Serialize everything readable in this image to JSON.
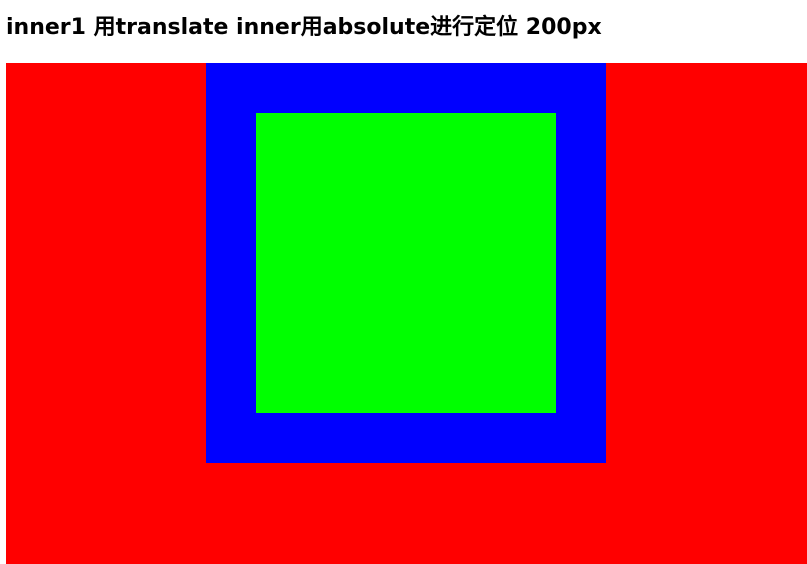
{
  "heading": {
    "text": "inner1 用translate inner用absolute进行定位 200px"
  },
  "colors": {
    "outer": "#ff0000",
    "inner1": "#0000ff",
    "inner": "#00ff00"
  }
}
